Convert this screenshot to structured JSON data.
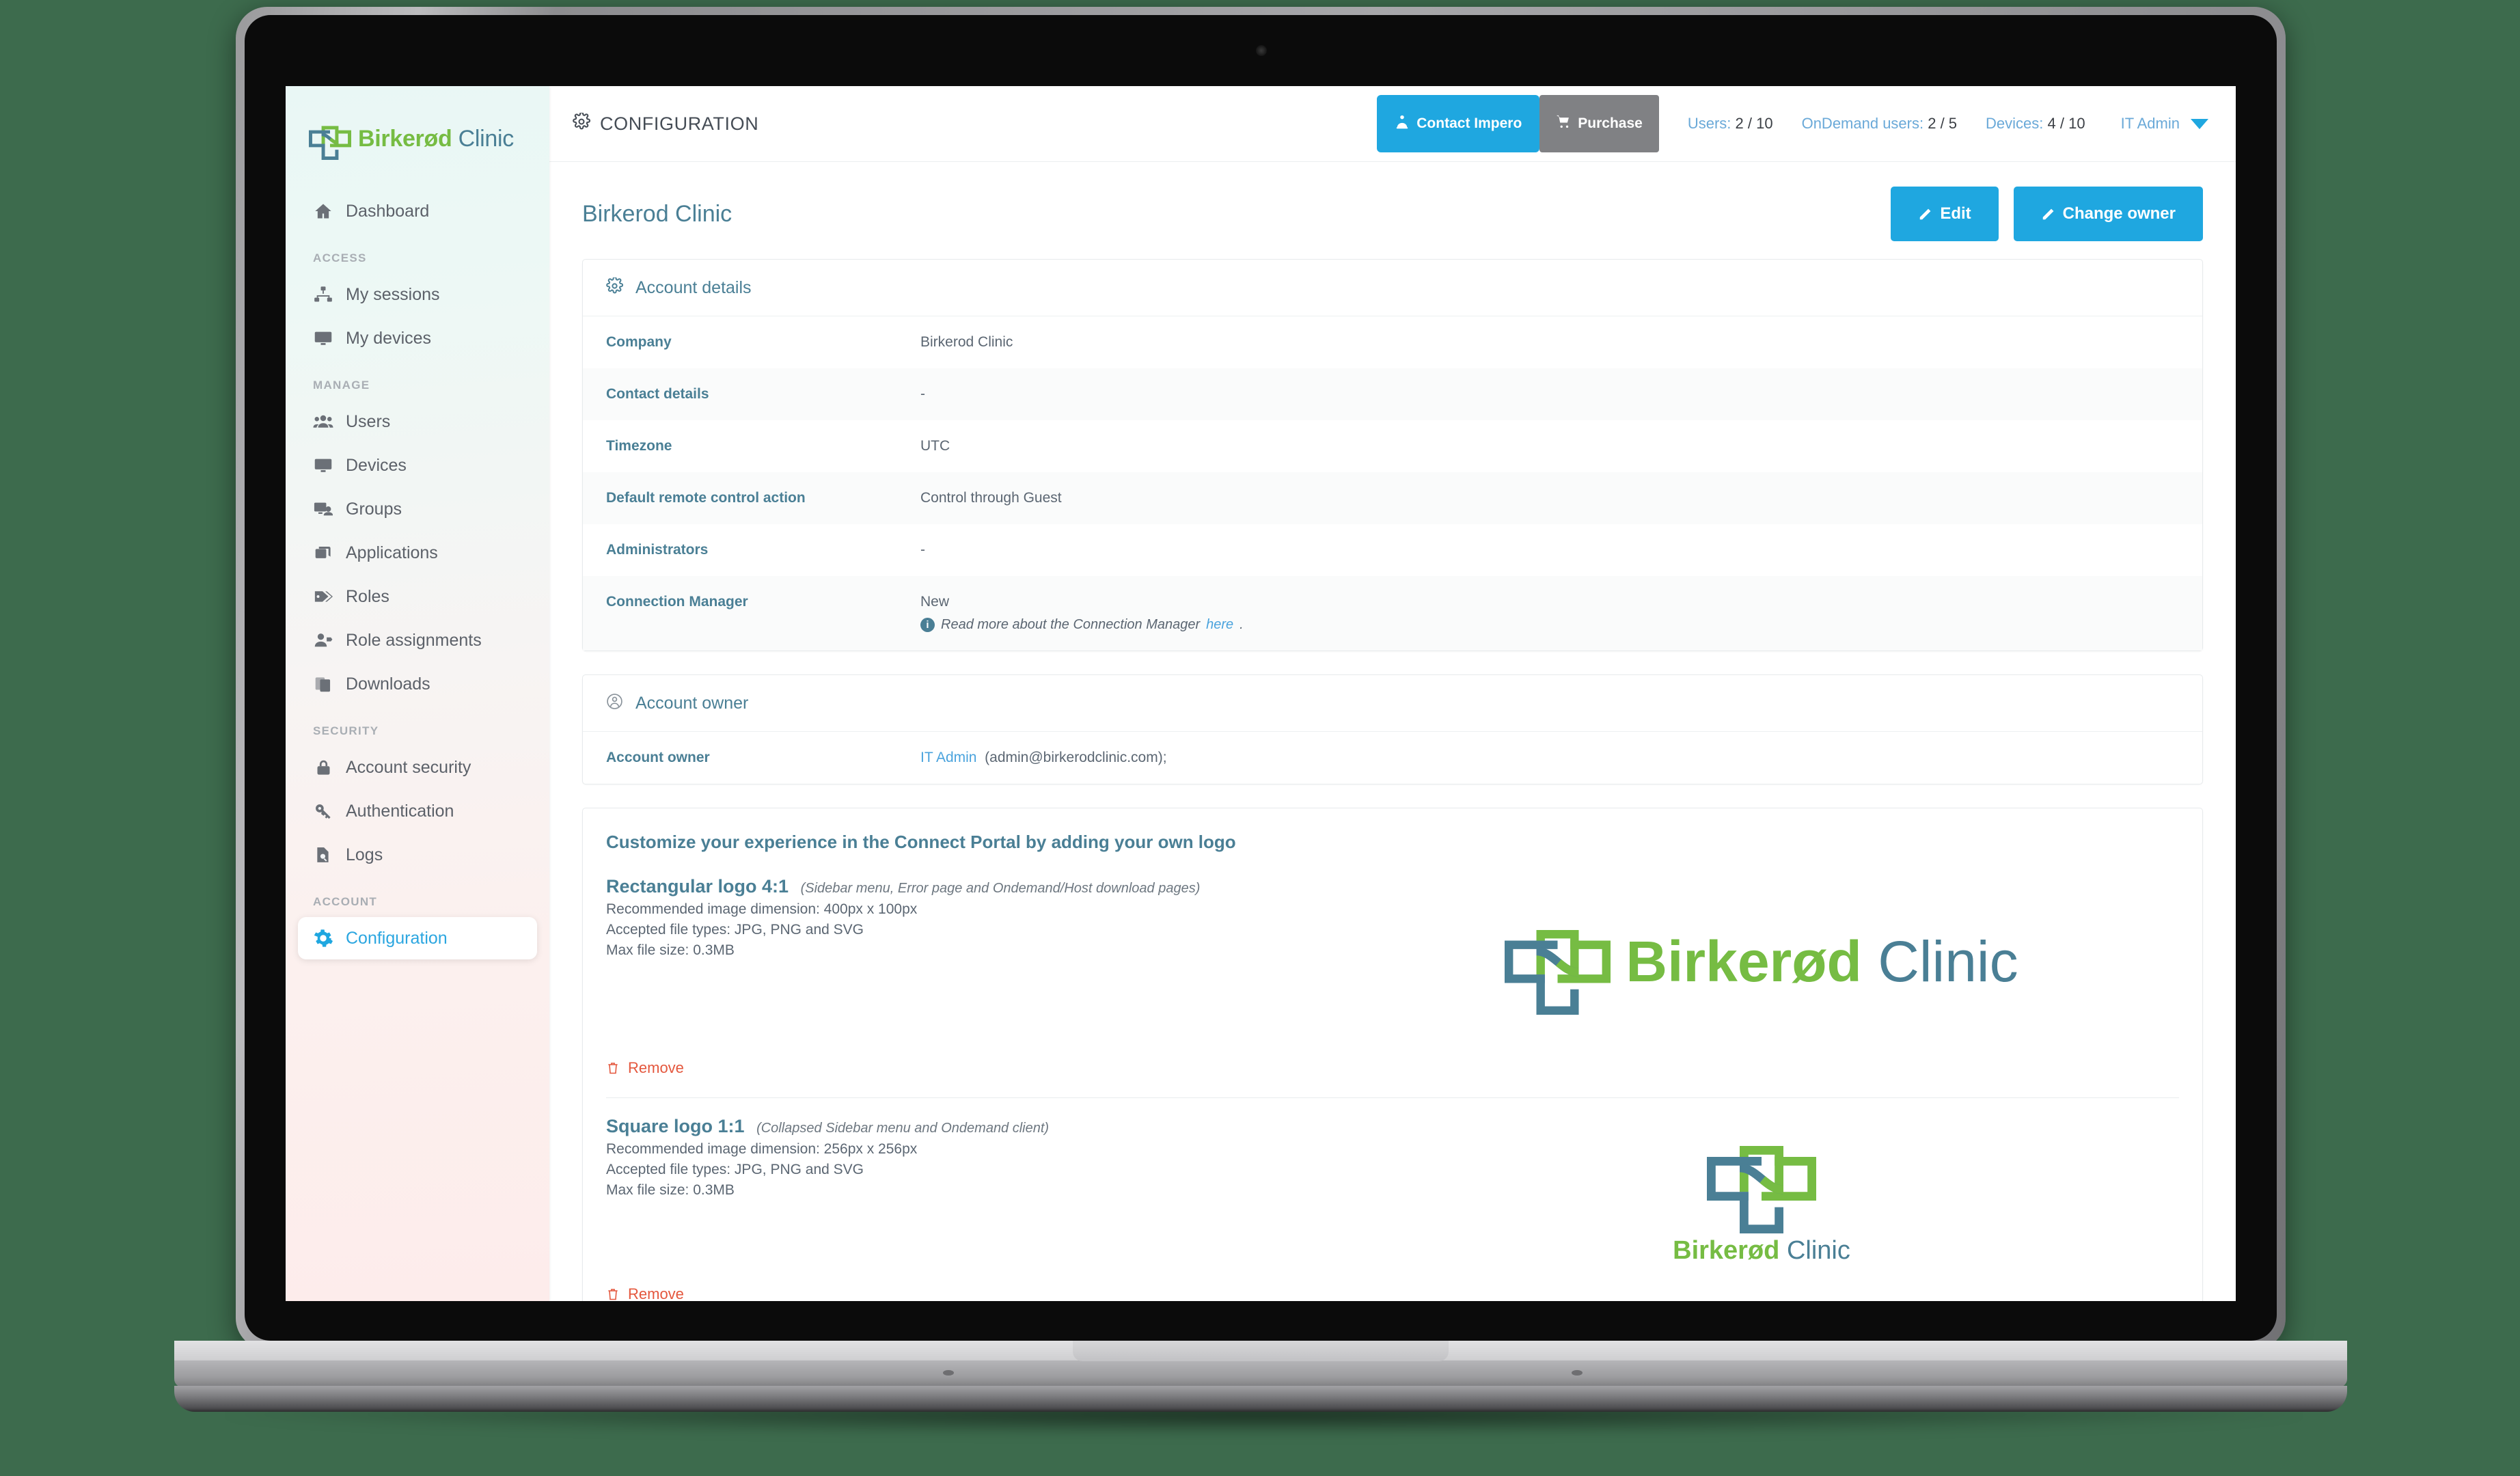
{
  "brand": {
    "name_primary": "Birkerød",
    "name_secondary": "Clinic",
    "green": "#76bc43",
    "blue": "#4a7f95"
  },
  "sidebar": {
    "items": [
      {
        "label": "Dashboard",
        "icon": "home-icon",
        "kind": "item",
        "key": "dashboard"
      },
      {
        "label": "ACCESS",
        "kind": "section"
      },
      {
        "label": "My sessions",
        "icon": "sitemap-icon",
        "kind": "item",
        "key": "my-sessions"
      },
      {
        "label": "My devices",
        "icon": "monitor-icon",
        "kind": "item",
        "key": "my-devices"
      },
      {
        "label": "MANAGE",
        "kind": "section"
      },
      {
        "label": "Users",
        "icon": "users-icon",
        "kind": "item",
        "key": "users"
      },
      {
        "label": "Devices",
        "icon": "monitor-icon",
        "kind": "item",
        "key": "devices"
      },
      {
        "label": "Groups",
        "icon": "groups-icon",
        "kind": "item",
        "key": "groups"
      },
      {
        "label": "Applications",
        "icon": "windows-icon",
        "kind": "item",
        "key": "applications"
      },
      {
        "label": "Roles",
        "icon": "tags-icon",
        "kind": "item",
        "key": "roles"
      },
      {
        "label": "Role assignments",
        "icon": "user-tag-icon",
        "kind": "item",
        "key": "role-assignments"
      },
      {
        "label": "Downloads",
        "icon": "copy-icon",
        "kind": "item",
        "key": "downloads"
      },
      {
        "label": "SECURITY",
        "kind": "section"
      },
      {
        "label": "Account security",
        "icon": "lock-icon",
        "kind": "item",
        "key": "account-security"
      },
      {
        "label": "Authentication",
        "icon": "key-icon",
        "kind": "item",
        "key": "authentication"
      },
      {
        "label": "Logs",
        "icon": "file-search-icon",
        "kind": "item",
        "key": "logs"
      },
      {
        "label": "ACCOUNT",
        "kind": "section"
      },
      {
        "label": "Configuration",
        "icon": "gear-icon",
        "kind": "item",
        "key": "configuration",
        "active": true
      }
    ]
  },
  "topbar": {
    "kicker": "CONFIGURATION",
    "contact_label": "Contact Impero",
    "purchase_label": "Purchase",
    "meters": [
      {
        "label": "Users:",
        "value": "2 / 10"
      },
      {
        "label": "OnDemand users:",
        "value": "2 / 5"
      },
      {
        "label": "Devices:",
        "value": "4 / 10"
      }
    ],
    "user_name": "IT Admin"
  },
  "page": {
    "title": "Birkerod Clinic",
    "edit_label": "Edit",
    "change_owner_label": "Change owner"
  },
  "account_details": {
    "heading": "Account details",
    "rows": [
      {
        "key": "Company",
        "value": "Birkerod Clinic"
      },
      {
        "key": "Contact details",
        "value": "-"
      },
      {
        "key": "Timezone",
        "value": "UTC"
      },
      {
        "key": "Default remote control action",
        "value": "Control through Guest"
      },
      {
        "key": "Administrators",
        "value": "-"
      },
      {
        "key": "Connection Manager",
        "value": "New",
        "hint_prefix": "Read more about the Connection Manager ",
        "hint_link": "here",
        "hint_suffix": "."
      }
    ]
  },
  "account_owner": {
    "heading": "Account owner",
    "row_key": "Account owner",
    "owner_name": "IT Admin",
    "owner_email": "(admin@birkerodclinic.com);"
  },
  "logo_section": {
    "title": "Customize your experience in the Connect Portal by adding your own logo",
    "blocks": [
      {
        "name": "Rectangular logo 4:1",
        "usage": "(Sidebar menu, Error page and Ondemand/Host download pages)",
        "dimension": "Recommended image dimension: 400px x 100px",
        "types": "Accepted file types: JPG, PNG and SVG",
        "maxsize": "Max file size: 0.3MB",
        "remove_label": "Remove",
        "preview": "rectangular"
      },
      {
        "name": "Square logo 1:1",
        "usage": "(Collapsed Sidebar menu and Ondemand client)",
        "dimension": "Recommended image dimension: 256px x 256px",
        "types": "Accepted file types: JPG, PNG and SVG",
        "maxsize": "Max file size: 0.3MB",
        "remove_label": "Remove",
        "preview": "square"
      }
    ]
  },
  "colors": {
    "accent_blue": "#1fa7e0",
    "link_blue": "#4aa3dd",
    "slate": "#4a7f95",
    "grey_button": "#808184",
    "danger": "#e4573d",
    "desktop_bg": "#3d6b4d"
  }
}
